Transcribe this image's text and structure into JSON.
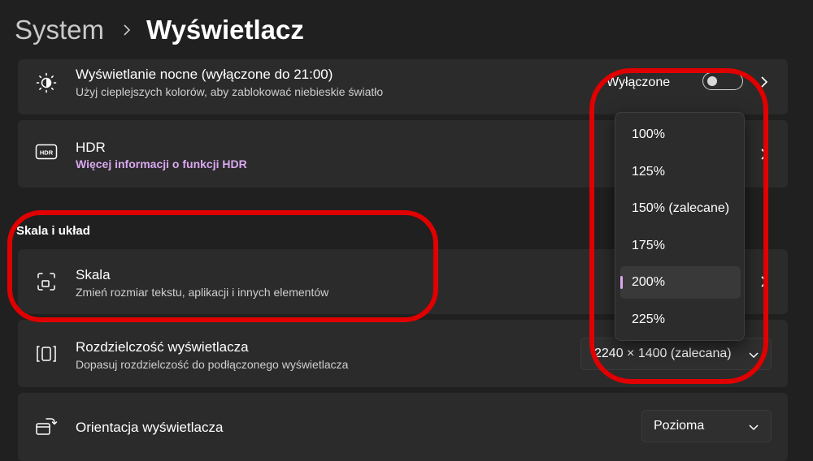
{
  "breadcrumb": {
    "parent": "System",
    "current": "Wyświetlacz"
  },
  "night_light": {
    "title": "Wyświetlanie nocne (wyłączone do 21:00)",
    "subtitle": "Użyj cieplejszych kolorów, aby zablokować niebieskie światło",
    "toggle_label": "Wyłączone",
    "toggle_on": false,
    "icon": "brightness-icon"
  },
  "hdr": {
    "title": "HDR",
    "link": "Więcej informacji o funkcji HDR",
    "icon": "hdr-icon"
  },
  "section": {
    "scale_layout": "Skala i układ"
  },
  "scale": {
    "title": "Skala",
    "subtitle": "Zmień rozmiar tekstu, aplikacji i innych elementów",
    "icon": "scale-icon",
    "options": [
      "100%",
      "125%",
      "150% (zalecane)",
      "175%",
      "200%",
      "225%"
    ],
    "selected": "200%"
  },
  "resolution": {
    "title": "Rozdzielczość wyświetlacza",
    "subtitle": "Dopasuj rozdzielczość do podłączonego wyświetlacza",
    "value": "2240 × 1400 (zalecana)",
    "icon": "resolution-icon"
  },
  "orientation": {
    "title": "Orientacja wyświetlacza",
    "value": "Pozioma",
    "icon": "orientation-icon"
  },
  "colors": {
    "background": "#202020",
    "card": "#2b2b2b",
    "accent": "#d9a8f0",
    "annotation": "#e00000"
  }
}
